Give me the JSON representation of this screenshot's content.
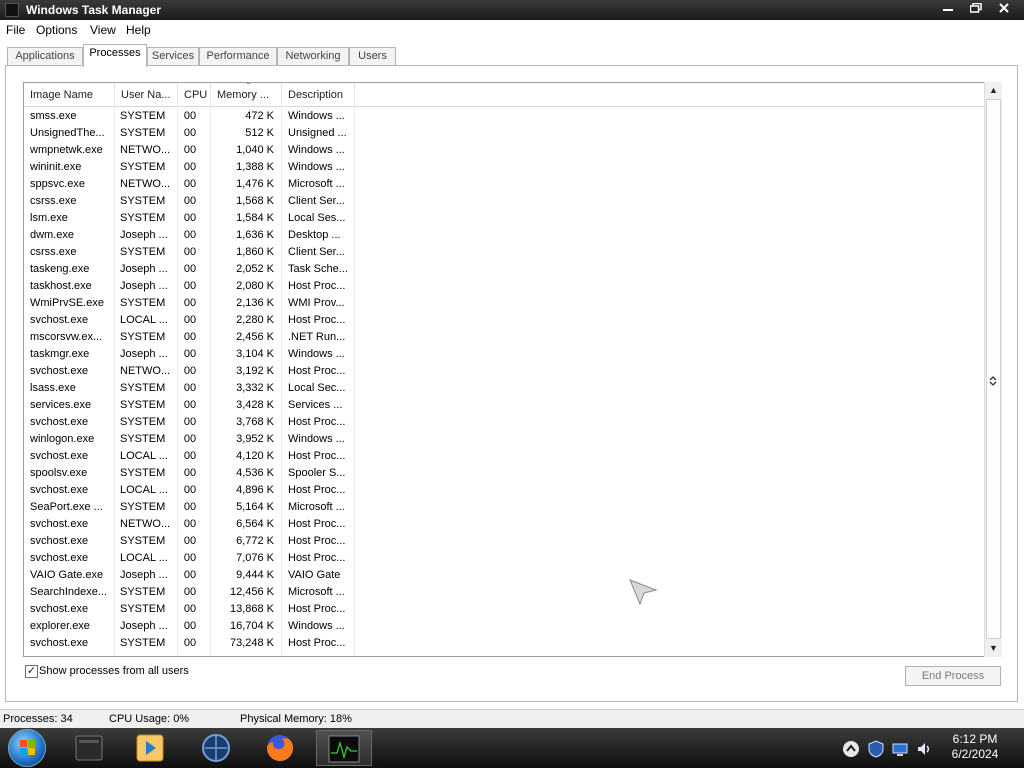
{
  "window": {
    "title": "Windows Task Manager",
    "controls": {
      "minimize": "minimize-icon",
      "maximize": "maximize-icon",
      "close": "close-icon"
    }
  },
  "menu": {
    "items": [
      "File",
      "Options",
      "View",
      "Help"
    ]
  },
  "tabs": [
    {
      "label": "Applications",
      "active": false
    },
    {
      "label": "Processes",
      "active": true
    },
    {
      "label": "Services",
      "active": false
    },
    {
      "label": "Performance",
      "active": false
    },
    {
      "label": "Networking",
      "active": false
    },
    {
      "label": "Users",
      "active": false
    }
  ],
  "table": {
    "columns": [
      "Image Name",
      "User Na...",
      "CPU",
      "Memory ...",
      "Description"
    ],
    "rows": [
      [
        "smss.exe",
        "SYSTEM",
        "00",
        "472 K",
        "Windows ..."
      ],
      [
        "UnsignedThe...",
        "SYSTEM",
        "00",
        "512 K",
        "Unsigned ..."
      ],
      [
        "wmpnetwk.exe",
        "NETWO...",
        "00",
        "1,040 K",
        "Windows ..."
      ],
      [
        "wininit.exe",
        "SYSTEM",
        "00",
        "1,388 K",
        "Windows ..."
      ],
      [
        "sppsvc.exe",
        "NETWO...",
        "00",
        "1,476 K",
        "Microsoft ..."
      ],
      [
        "csrss.exe",
        "SYSTEM",
        "00",
        "1,568 K",
        "Client Ser..."
      ],
      [
        "lsm.exe",
        "SYSTEM",
        "00",
        "1,584 K",
        "Local Ses..."
      ],
      [
        "dwm.exe",
        "Joseph ...",
        "00",
        "1,636 K",
        "Desktop ..."
      ],
      [
        "csrss.exe",
        "SYSTEM",
        "00",
        "1,860 K",
        "Client Ser..."
      ],
      [
        "taskeng.exe",
        "Joseph ...",
        "00",
        "2,052 K",
        "Task Sche..."
      ],
      [
        "taskhost.exe",
        "Joseph ...",
        "00",
        "2,080 K",
        "Host Proc..."
      ],
      [
        "WmiPrvSE.exe",
        "SYSTEM",
        "00",
        "2,136 K",
        "WMI Prov..."
      ],
      [
        "svchost.exe",
        "LOCAL ...",
        "00",
        "2,280 K",
        "Host Proc..."
      ],
      [
        "mscorsvw.ex...",
        "SYSTEM",
        "00",
        "2,456 K",
        ".NET Run..."
      ],
      [
        "taskmgr.exe",
        "Joseph ...",
        "00",
        "3,104 K",
        "Windows ..."
      ],
      [
        "svchost.exe",
        "NETWO...",
        "00",
        "3,192 K",
        "Host Proc..."
      ],
      [
        "lsass.exe",
        "SYSTEM",
        "00",
        "3,332 K",
        "Local Sec..."
      ],
      [
        "services.exe",
        "SYSTEM",
        "00",
        "3,428 K",
        "Services ..."
      ],
      [
        "svchost.exe",
        "SYSTEM",
        "00",
        "3,768 K",
        "Host Proc..."
      ],
      [
        "winlogon.exe",
        "SYSTEM",
        "00",
        "3,952 K",
        "Windows ..."
      ],
      [
        "svchost.exe",
        "LOCAL ...",
        "00",
        "4,120 K",
        "Host Proc..."
      ],
      [
        "spoolsv.exe",
        "SYSTEM",
        "00",
        "4,536 K",
        "Spooler S..."
      ],
      [
        "svchost.exe",
        "LOCAL ...",
        "00",
        "4,896 K",
        "Host Proc..."
      ],
      [
        "SeaPort.exe ...",
        "SYSTEM",
        "00",
        "5,164 K",
        "Microsoft ..."
      ],
      [
        "svchost.exe",
        "NETWO...",
        "00",
        "6,564 K",
        "Host Proc..."
      ],
      [
        "svchost.exe",
        "SYSTEM",
        "00",
        "6,772 K",
        "Host Proc..."
      ],
      [
        "svchost.exe",
        "LOCAL ...",
        "00",
        "7,076 K",
        "Host Proc..."
      ],
      [
        "VAIO Gate.exe",
        "Joseph ...",
        "00",
        "9,444 K",
        "VAIO Gate"
      ],
      [
        "SearchIndexe...",
        "SYSTEM",
        "00",
        "12,456 K",
        "Microsoft ..."
      ],
      [
        "svchost.exe",
        "SYSTEM",
        "00",
        "13,868 K",
        "Host Proc..."
      ],
      [
        "explorer.exe",
        "Joseph ...",
        "00",
        "16,704 K",
        "Windows ..."
      ],
      [
        "svchost.exe",
        "SYSTEM",
        "00",
        "73,248 K",
        "Host Proc..."
      ]
    ]
  },
  "show_all_users": {
    "label": "Show processes from all users",
    "checked": true
  },
  "end_process": {
    "label": "End Process",
    "enabled": false
  },
  "status": {
    "processes": "Processes: 34",
    "cpu": "CPU Usage: 0%",
    "memory": "Physical Memory: 18%"
  },
  "taskbar": {
    "items": [
      "start-orb-icon",
      "file-manager-icon",
      "media-player-icon",
      "network-app-icon",
      "firefox-icon",
      "task-manager-icon"
    ],
    "tray_icons": [
      "show-hidden-icons-icon",
      "security-shield-icon",
      "network-icon",
      "volume-icon"
    ],
    "clock_time": "6:12 PM",
    "clock_date": "6/2/2024"
  },
  "colors": {
    "titlebar": "#1b1b1b",
    "taskbar": "#0e0e0e",
    "panel_border": "#b5b5b5"
  }
}
